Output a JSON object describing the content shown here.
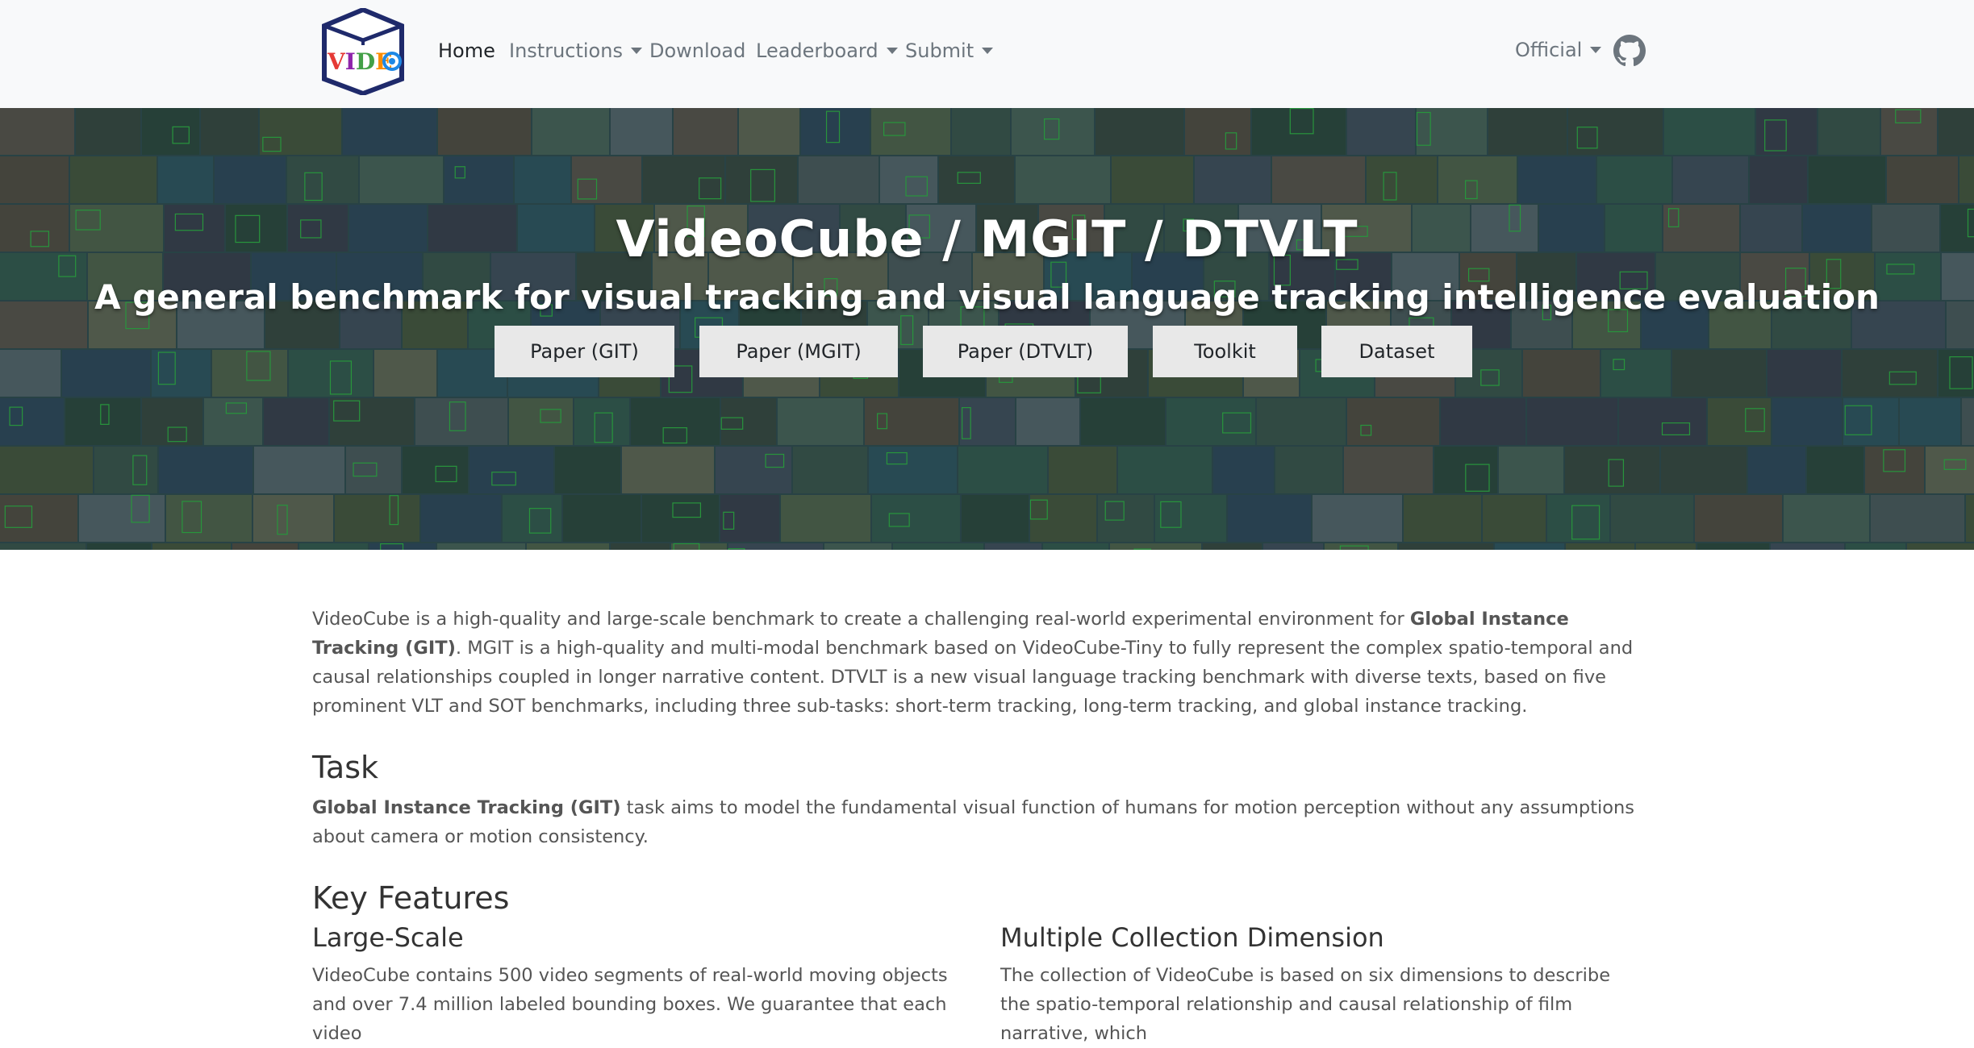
{
  "nav": {
    "brand_text": "VIDEO",
    "items": [
      {
        "label": "Home",
        "dropdown": false,
        "active": true
      },
      {
        "label": "Instructions",
        "dropdown": true,
        "active": false
      },
      {
        "label": "Download",
        "dropdown": false,
        "active": false
      },
      {
        "label": "Leaderboard",
        "dropdown": true,
        "active": false
      },
      {
        "label": "Submit",
        "dropdown": true,
        "active": false
      }
    ],
    "right_menu": {
      "label": "Official",
      "dropdown": true
    },
    "github_icon": "github-icon"
  },
  "hero": {
    "title": "VideoCube / MGIT / DTVLT",
    "subtitle": "A general benchmark for visual tracking and visual language tracking intelligence evaluation",
    "buttons": [
      "Paper (GIT)",
      "Paper (MGIT)",
      "Paper (DTVLT)",
      "Toolkit",
      "Dataset"
    ]
  },
  "intro": {
    "part1": "VideoCube is a high-quality and large-scale benchmark to create a challenging real-world experimental environment for ",
    "bold": "Global Instance Tracking (GIT)",
    "part2": ". MGIT is a high-quality and multi-modal benchmark based on VideoCube-Tiny to fully represent the complex spatio-temporal and causal relationships coupled in longer narrative content. DTVLT is a new visual language tracking benchmark with diverse texts, based on five prominent VLT and SOT benchmarks, including three sub-tasks: short-term tracking, long-term tracking, and global instance tracking."
  },
  "task": {
    "heading": "Task",
    "bold": "Global Instance Tracking (GIT)",
    "text": " task aims to model the fundamental visual function of humans for motion perception without any assumptions about camera or motion consistency."
  },
  "features": {
    "heading": "Key Features",
    "left": {
      "title": "Large-Scale",
      "text": "VideoCube contains 500 video segments of real-world moving objects and over 7.4 million labeled bounding boxes. We guarantee that each video"
    },
    "right": {
      "title": "Multiple Collection Dimension",
      "text": "The collection of VideoCube is based on six dimensions to describe the spatio-temporal relationship and causal relationship of film narrative, which"
    }
  },
  "colors": {
    "navbar_bg": "#f8f9fa",
    "nav_text": "#6c757d",
    "nav_active": "#212529",
    "logo_border": "#1f2a6b",
    "button_bg": "#e8e8e8"
  }
}
